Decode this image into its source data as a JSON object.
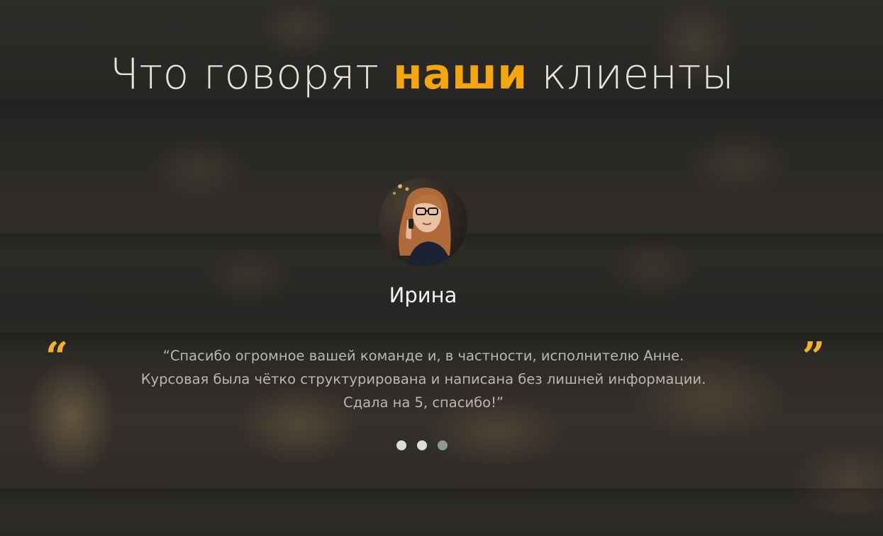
{
  "heading": {
    "before": "Что говорят ",
    "accent": "наши",
    "after": " клиенты"
  },
  "testimonial": {
    "name": "Ирина",
    "quote": "“Спасибо огромное вашей команде и, в частности, исполнителю Анне.\nКурсовая была чётко структурирована и написана без лишней информации.\nСдала на 5, спасибо!”",
    "open_mark": "“",
    "close_mark": "”"
  },
  "carousel": {
    "slide_count": 3,
    "active_index": 2
  },
  "colors": {
    "accent": "#f5a60a",
    "quote_mark": "#f1b12a",
    "heading_text": "#e6e3dd",
    "body_text": "#b9b7b2",
    "dot_inactive": "#dcdcdc",
    "dot_active": "#8a9a93"
  }
}
